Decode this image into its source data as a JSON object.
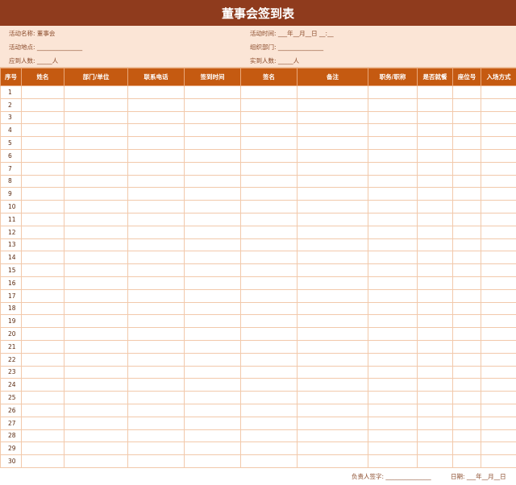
{
  "title": "董事会签到表",
  "info": {
    "activity_name": "活动名称:  董事会",
    "activity_time": "活动时间:  ___年__月__日  __:__",
    "activity_place": "活动地点:  _______________",
    "organizer": "组织部门:  _______________",
    "expected": "应到人数:  _____人",
    "actual": "实到人数:  _____人"
  },
  "columns": [
    "序号",
    "姓名",
    "部门/单位",
    "联系电话",
    "签到时间",
    "签名",
    "备注",
    "职务/职称",
    "是否就餐",
    "座位号",
    "入场方式"
  ],
  "rows": [
    "1",
    "2",
    "3",
    "4",
    "5",
    "6",
    "7",
    "8",
    "9",
    "10",
    "11",
    "12",
    "13",
    "14",
    "15",
    "16",
    "17",
    "18",
    "19",
    "20",
    "21",
    "22",
    "23",
    "24",
    "25",
    "26",
    "27",
    "28",
    "29",
    "30"
  ],
  "footer": {
    "signer": "负责人签字:  _______________",
    "date": "日期:  ___年__月__日"
  },
  "colors": {
    "title_bg": "#8f3b1d",
    "info_bg": "#fbe5d6",
    "header_bg": "#c55a11",
    "grid_line": "#f2c9ab"
  }
}
